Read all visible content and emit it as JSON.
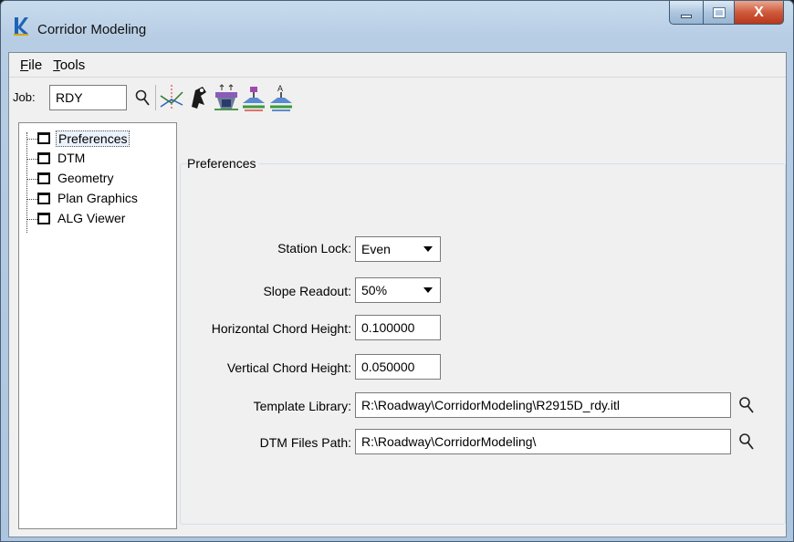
{
  "window": {
    "title": "Corridor Modeling"
  },
  "menu": {
    "file": "File",
    "file_mnemonic": "F",
    "file_rest": "ile",
    "tools": "Tools",
    "tools_mnemonic": "T",
    "tools_rest": "ools"
  },
  "toolbar": {
    "job_label": "Job:",
    "job_value": "RDY",
    "buttons": [
      "alignment-tool-icon",
      "driver-tool-icon",
      "roadway-lanes-icon",
      "cross-section-icon",
      "template-icon"
    ]
  },
  "tree": {
    "items": [
      {
        "label": "Preferences",
        "selected": true
      },
      {
        "label": "DTM",
        "selected": false
      },
      {
        "label": "Geometry",
        "selected": false
      },
      {
        "label": "Plan Graphics",
        "selected": false
      },
      {
        "label": "ALG Viewer",
        "selected": false
      }
    ]
  },
  "preferences": {
    "group_title": "Preferences",
    "station_lock": {
      "label": "Station Lock:",
      "value": "Even"
    },
    "slope_readout": {
      "label": "Slope Readout:",
      "value": "50%"
    },
    "horizontal_chord": {
      "label": "Horizontal Chord Height:",
      "value": "0.100000"
    },
    "vertical_chord": {
      "label": "Vertical Chord Height:",
      "value": "0.050000"
    },
    "template_library": {
      "label": "Template Library:",
      "value": "R:\\Roadway\\CorridorModeling\\R2915D_rdy.itl"
    },
    "dtm_files_path": {
      "label": "DTM Files Path:",
      "value": "R:\\Roadway\\CorridorModeling\\"
    }
  },
  "colors": {
    "titlebar": "#b7cde4",
    "close_button": "#cf5a3c",
    "selection": "#eaf2fb"
  }
}
